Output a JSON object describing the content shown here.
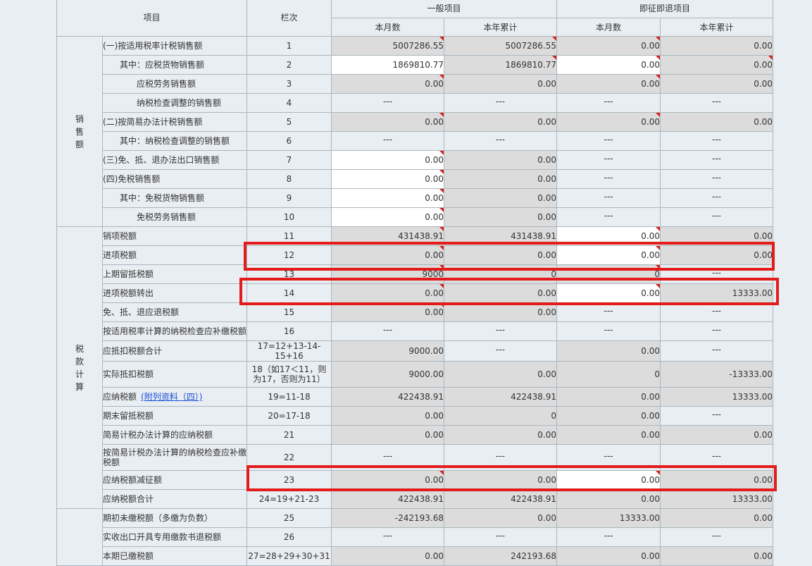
{
  "header": {
    "item": "项目",
    "line": "栏次",
    "general": "一般项目",
    "refund": "即征即退项目",
    "month": "本月数",
    "year": "本年累计"
  },
  "sections": {
    "sales": "销售额",
    "tax_calc": "税款计算"
  },
  "rows": [
    {
      "name": "(一)按适用税率计税销售额",
      "indent": 0,
      "line": "1",
      "c1": "5007286.55",
      "c2": "5007286.55",
      "c3": "0.00",
      "c4": "0.00"
    },
    {
      "name": "其中：应税货物销售额",
      "indent": 1,
      "line": "2",
      "c1": "1869810.77",
      "c2": "1869810.77",
      "c3": "0.00",
      "c4": "0.00"
    },
    {
      "name": "应税劳务销售额",
      "indent": 2,
      "line": "3",
      "c1": "0.00",
      "c2": "0.00",
      "c3": "0.00",
      "c4": "0.00"
    },
    {
      "name": "纳税检查调整的销售额",
      "indent": 2,
      "line": "4",
      "c1": "---",
      "c2": "---",
      "c3": "---",
      "c4": "---"
    },
    {
      "name": "(二)按简易办法计税销售额",
      "indent": 0,
      "line": "5",
      "c1": "0.00",
      "c2": "0.00",
      "c3": "0.00",
      "c4": "0.00"
    },
    {
      "name": "其中：纳税检查调整的销售额",
      "indent": 1,
      "line": "6",
      "c1": "---",
      "c2": "---",
      "c3": "---",
      "c4": "---"
    },
    {
      "name": "(三)免、抵、退办法出口销售额",
      "indent": 0,
      "line": "7",
      "c1": "0.00",
      "c2": "0.00",
      "c3": "---",
      "c4": "---"
    },
    {
      "name": "(四)免税销售额",
      "indent": 0,
      "line": "8",
      "c1": "0.00",
      "c2": "0.00",
      "c3": "---",
      "c4": "---"
    },
    {
      "name": "其中：免税货物销售额",
      "indent": 1,
      "line": "9",
      "c1": "0.00",
      "c2": "0.00",
      "c3": "---",
      "c4": "---"
    },
    {
      "name": "免税劳务销售额",
      "indent": 2,
      "line": "10",
      "c1": "0.00",
      "c2": "0.00",
      "c3": "---",
      "c4": "---"
    },
    {
      "name": "销项税额",
      "indent": 0,
      "line": "11",
      "c1": "431438.91",
      "c2": "431438.91",
      "c3": "0.00",
      "c4": "0.00"
    },
    {
      "name": "进项税额",
      "indent": 0,
      "line": "12",
      "c1": "0.00",
      "c2": "0.00",
      "c3": "0.00",
      "c4": "0.00"
    },
    {
      "name": "上期留抵税额",
      "indent": 0,
      "line": "13",
      "c1": "9000",
      "c2": "0",
      "c3": "0",
      "c4": "---"
    },
    {
      "name": "进项税额转出",
      "indent": 0,
      "line": "14",
      "c1": "0.00",
      "c2": "0.00",
      "c3": "0.00",
      "c4": "13333.00"
    },
    {
      "name": "免、抵、退应退税额",
      "indent": 0,
      "line": "15",
      "c1": "0.00",
      "c2": "0.00",
      "c3": "---",
      "c4": "---"
    },
    {
      "name": "按适用税率计算的纳税检查应补缴税额",
      "indent": 0,
      "line": "16",
      "c1": "---",
      "c2": "---",
      "c3": "---",
      "c4": "---"
    },
    {
      "name": "应抵扣税额合计",
      "indent": 0,
      "line": "17=12+13-14-15+16",
      "c1": "9000.00",
      "c2": "---",
      "c3": "0.00",
      "c4": "---"
    },
    {
      "name": "实际抵扣税额",
      "indent": 0,
      "line": "18（如17＜11，则为17，否则为11）",
      "c1": "9000.00",
      "c2": "0.00",
      "c3": "0",
      "c4": "-13333.00"
    },
    {
      "name": "应纳税额",
      "link": "(附列资料（四）)",
      "indent": 0,
      "line": "19=11-18",
      "c1": "422438.91",
      "c2": "422438.91",
      "c3": "0.00",
      "c4": "13333.00"
    },
    {
      "name": "期末留抵税额",
      "indent": 0,
      "line": "20=17-18",
      "c1": "0.00",
      "c2": "0",
      "c3": "0.00",
      "c4": "---"
    },
    {
      "name": "简易计税办法计算的应纳税额",
      "indent": 0,
      "line": "21",
      "c1": "0.00",
      "c2": "0.00",
      "c3": "0.00",
      "c4": "0.00"
    },
    {
      "name": "按简易计税办法计算的纳税检查应补缴税额",
      "indent": 0,
      "line": "22",
      "c1": "---",
      "c2": "---",
      "c3": "---",
      "c4": "---"
    },
    {
      "name": "应纳税额减征额",
      "indent": 0,
      "line": "23",
      "c1": "0.00",
      "c2": "0.00",
      "c3": "0.00",
      "c4": "0.00"
    },
    {
      "name": "应纳税额合计",
      "indent": 0,
      "line": "24=19+21-23",
      "c1": "422438.91",
      "c2": "422438.91",
      "c3": "0.00",
      "c4": "13333.00"
    },
    {
      "name": "期初未缴税额（多缴为负数）",
      "indent": 0,
      "line": "25",
      "c1": "-242193.68",
      "c2": "0.00",
      "c3": "13333.00",
      "c4": "0.00"
    },
    {
      "name": "实收出口开具专用缴款书退税额",
      "indent": 0,
      "line": "26",
      "c1": "---",
      "c2": "---",
      "c3": "---",
      "c4": "---"
    },
    {
      "name": "本期已缴税额",
      "indent": 0,
      "line": "27=28+29+30+31",
      "c1": "0.00",
      "c2": "242193.68",
      "c3": "0.00",
      "c4": "0.00"
    }
  ],
  "colors": {
    "highlight": "#e41b1b",
    "readonly_cell": "#dcdcdc",
    "editable_cell": "#ffffff",
    "link": "#1a4fd6"
  }
}
